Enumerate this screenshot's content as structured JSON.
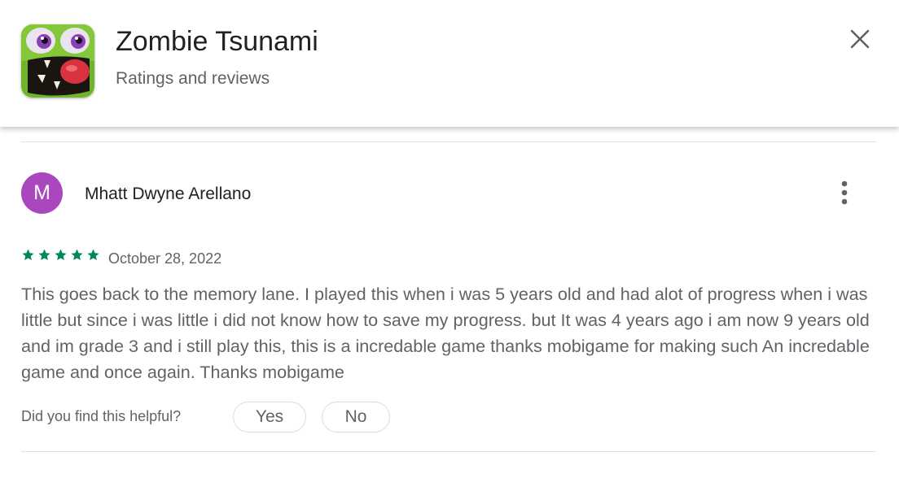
{
  "header": {
    "app_icon": "zombie-tsunami-app-icon",
    "title": "Zombie Tsunami",
    "subtitle": "Ratings and reviews",
    "close_icon": "close-icon"
  },
  "review": {
    "avatar_letter": "M",
    "avatar_color": "#ab47bc",
    "author": "Mhatt Dwyne Arellano",
    "more_icon": "more-vert-icon",
    "rating": 5,
    "max_rating": 5,
    "star_color": "#01875f",
    "date": "October 28, 2022",
    "text": "This goes back to the memory lane. I played this when i was 5 years old and had alot of progress when i was little but since i was little i did not know how to save my progress. but It was 4 years ago i am now 9 years old and im grade 3 and i still play this, this is a incredable game thanks mobigame for making such An incredable game and once again. Thanks mobigame",
    "helpful_question": "Did you find this helpful?",
    "yes_label": "Yes",
    "no_label": "No"
  }
}
